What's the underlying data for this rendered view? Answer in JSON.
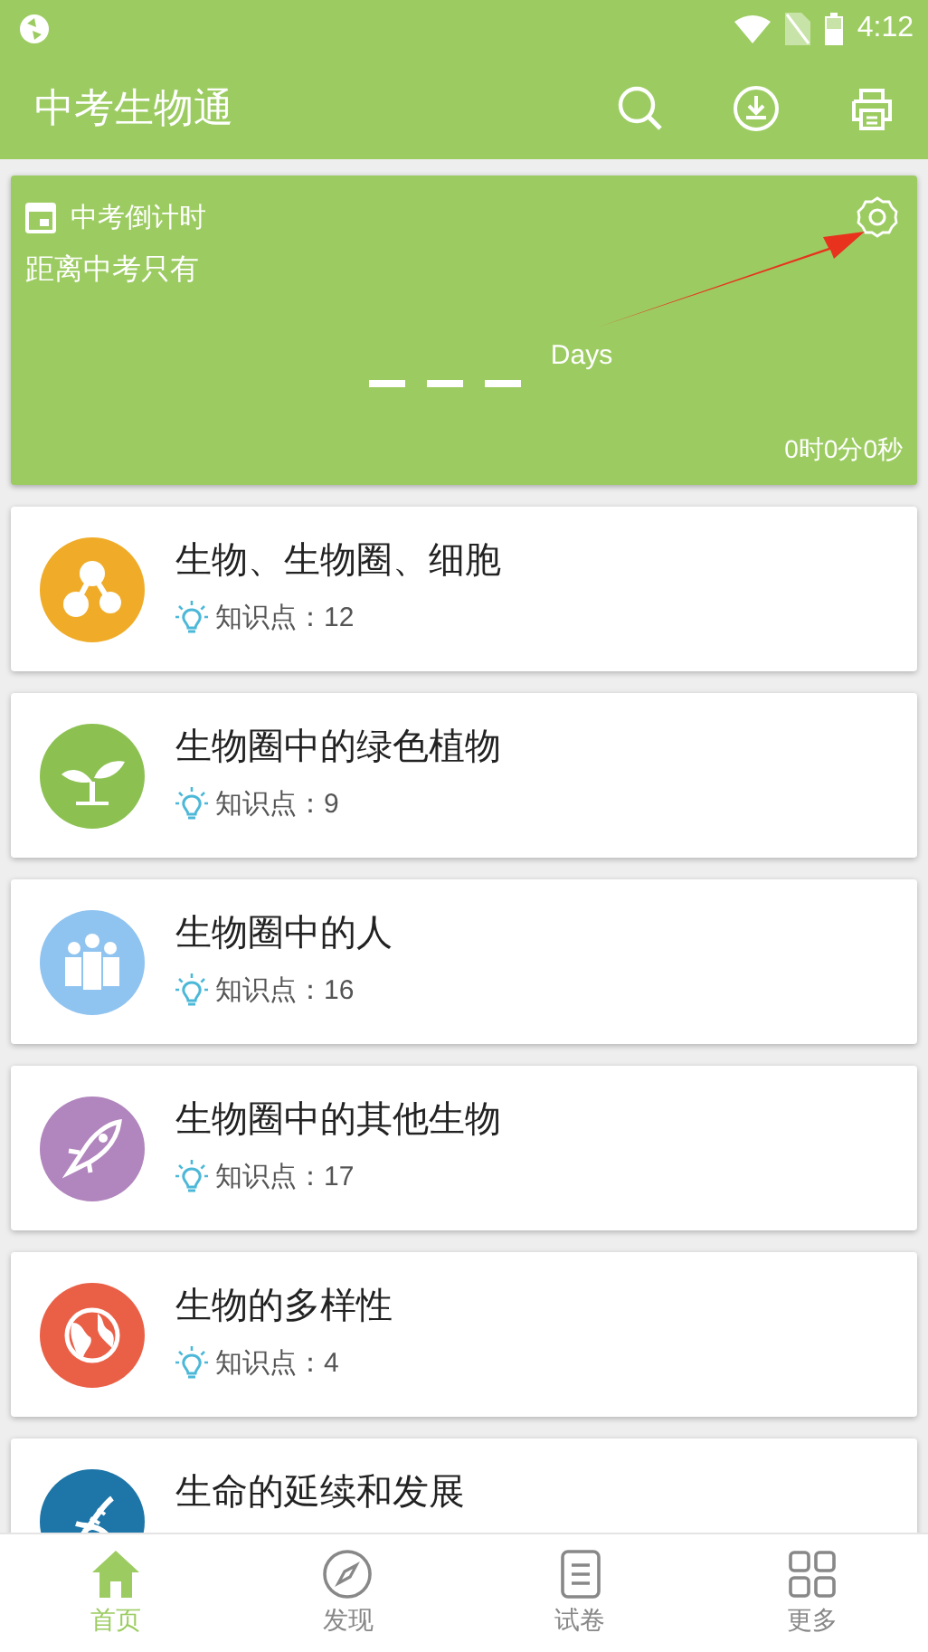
{
  "status_bar": {
    "time": "4:12"
  },
  "app_bar": {
    "title": "中考生物通"
  },
  "countdown": {
    "title": "中考倒计时",
    "subtitle": "距离中考只有",
    "unit": "Days",
    "remaining": "0时0分0秒"
  },
  "topics": [
    {
      "title": "生物、生物圈、细胞",
      "count_label": "知识点：12",
      "color": "#f0ac28"
    },
    {
      "title": "生物圈中的绿色植物",
      "count_label": "知识点：9",
      "color": "#8cc152"
    },
    {
      "title": "生物圈中的人",
      "count_label": "知识点：16",
      "color": "#8fc3f0"
    },
    {
      "title": "生物圈中的其他生物",
      "count_label": "知识点：17",
      "color": "#b185bd"
    },
    {
      "title": "生物的多样性",
      "count_label": "知识点：4",
      "color": "#ea6047"
    },
    {
      "title": "生命的延续和发展",
      "color": "#1d75a8"
    }
  ],
  "nav": [
    {
      "label": "首页",
      "selected": true
    },
    {
      "label": "发现",
      "selected": false
    },
    {
      "label": "试卷",
      "selected": false
    },
    {
      "label": "更多",
      "selected": false
    }
  ]
}
